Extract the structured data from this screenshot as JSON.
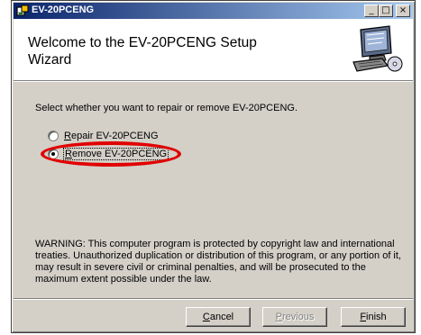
{
  "window": {
    "title": "EV-20PCENG",
    "controls": [
      "minimize-icon",
      "maximize-icon",
      "close-icon"
    ]
  },
  "banner": {
    "title": "Welcome to the EV-20PCENG Setup Wizard",
    "icon": "computer-setup-icon"
  },
  "instruction": "Select whether you want to repair or remove EV-20PCENG.",
  "options": [
    {
      "label": "Repair EV-20PCENG",
      "mnemonic": "R",
      "rest": "epair EV-20PCENG",
      "selected": false
    },
    {
      "label": "Remove EV-20PCENG",
      "mnemonic": "R",
      "rest": "emove EV-20PCENG",
      "selected": true
    }
  ],
  "warning": "WARNING: This computer program is protected by copyright law and international treaties. Unauthorized duplication or distribution of this program, or any portion of it, may result in severe civil or criminal penalties, and will be prosecuted to the maximum extent possible under the law.",
  "buttons": {
    "cancel": {
      "mnemonic": "C",
      "rest": "ancel"
    },
    "previous": {
      "mnemonic": "P",
      "rest": "revious",
      "enabled": false
    },
    "finish": {
      "mnemonic": "F",
      "rest": "inish"
    }
  },
  "colors": {
    "titlebar_start": "#0a246a",
    "titlebar_end": "#a6caf0",
    "dialog_face": "#d4d0c8",
    "annotation": "#e00000"
  }
}
